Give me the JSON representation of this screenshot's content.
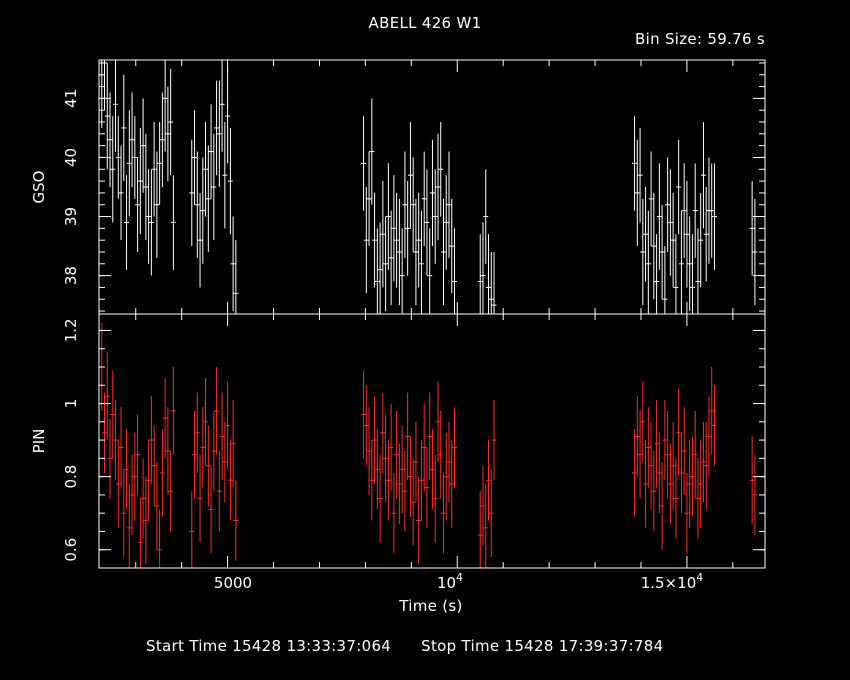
{
  "window": {
    "title": "ABELL 426 W1",
    "bin_size": "Bin Size: 59.76 s"
  },
  "footer": {
    "start": "Start Time 15428 13:33:37:064",
    "stop": "Stop Time 15428 17:39:37:784"
  },
  "colors": {
    "background": "#000000",
    "axes": "#ffffff",
    "gso_series": "#ffffff",
    "pin_series": "#ff2a2a"
  },
  "chart_data": [
    {
      "type": "scatter",
      "panel": "top",
      "ylabel": "GSO",
      "xlabel": "",
      "xlim": [
        2200,
        16700
      ],
      "ylim": [
        37.35,
        41.65
      ],
      "yticks": [
        38,
        39,
        40,
        41
      ],
      "grid": false,
      "series": [
        {
          "x": [
            2260,
            2320,
            2380,
            2440,
            2500,
            2560,
            2620,
            2680,
            2740,
            2800,
            2860,
            2920,
            2980,
            3040,
            3100,
            3160,
            3220,
            3280,
            3340,
            3400,
            3460,
            3520,
            3580,
            3640,
            3700,
            3760,
            3820,
            4220,
            4280,
            4340,
            4400,
            4460,
            4520,
            4580,
            4640,
            4700,
            4760,
            4820,
            4880,
            4940,
            5000,
            5060,
            5120,
            5180,
            7960,
            8020,
            8080,
            8140,
            8200,
            8260,
            8320,
            8380,
            8440,
            8500,
            8560,
            8620,
            8680,
            8740,
            8800,
            8860,
            8920,
            8980,
            9040,
            9100,
            9160,
            9220,
            9280,
            9340,
            9400,
            9460,
            9520,
            9580,
            9640,
            9700,
            9760,
            9820,
            9880,
            9940,
            10500,
            10560,
            10620,
            10680,
            10740,
            10800,
            13860,
            13920,
            13980,
            14040,
            14100,
            14160,
            14220,
            14280,
            14340,
            14400,
            14460,
            14520,
            14580,
            14640,
            14700,
            14760,
            14820,
            14880,
            14940,
            15000,
            15060,
            15120,
            15180,
            15240,
            15300,
            15360,
            15420,
            15480,
            15540,
            15600,
            16420,
            16480
          ],
          "y": [
            41.4,
            41.6,
            40.7,
            40.3,
            39.8,
            40.9,
            40.0,
            39.4,
            40.5,
            38.9,
            39.9,
            40.3,
            40.0,
            39.2,
            39.6,
            40.2,
            39.5,
            39.0,
            38.9,
            39.8,
            39.2,
            39.9,
            40.3,
            41.0,
            40.4,
            40.6,
            38.9,
            39.4,
            40.0,
            39.2,
            38.6,
            39.1,
            39.8,
            39.3,
            40.1,
            39.5,
            40.5,
            40.4,
            40.9,
            39.7,
            40.7,
            39.6,
            38.2,
            37.7,
            39.9,
            38.6,
            39.3,
            40.1,
            38.6,
            37.9,
            38.1,
            38.7,
            38.2,
            39.0,
            38.3,
            38.8,
            38.6,
            38.4,
            38.0,
            39.2,
            38.8,
            39.7,
            39.2,
            38.4,
            38.6,
            38.2,
            39.3,
            38.9,
            38.0,
            39.4,
            39.0,
            39.5,
            39.8,
            38.4,
            38.9,
            39.2,
            38.5,
            37.9,
            37.9,
            38.0,
            39.0,
            37.8,
            37.6,
            37.5,
            39.9,
            39.4,
            39.7,
            38.4,
            38.7,
            38.2,
            39.3,
            38.5,
            37.9,
            39.0,
            38.4,
            37.6,
            39.2,
            38.9,
            38.6,
            37.8,
            39.5,
            38.2,
            39.1,
            38.7,
            38.2,
            37.8,
            39.1,
            37.9,
            38.6,
            39.7,
            38.7,
            39.1,
            39.1,
            39.0,
            38.8,
            38.4
          ],
          "err": [
            0.9,
            0.8,
            0.9,
            0.8,
            0.9,
            0.8,
            0.7,
            0.8,
            0.9,
            0.8,
            0.9,
            0.8,
            0.7,
            0.8,
            0.9,
            0.8,
            0.9,
            0.8,
            0.9,
            0.8,
            0.9,
            0.7,
            0.8,
            0.9,
            0.8,
            0.9,
            0.8,
            0.9,
            0.8,
            0.9,
            0.8,
            0.9,
            0.8,
            0.9,
            0.8,
            0.9,
            0.8,
            0.9,
            0.8,
            0.9,
            0.8,
            0.9,
            0.8,
            0.9,
            0.8,
            0.9,
            0.8,
            0.9,
            0.8,
            0.9,
            0.8,
            0.9,
            0.8,
            0.9,
            0.8,
            0.9,
            0.8,
            0.9,
            0.8,
            0.9,
            0.8,
            0.9,
            0.8,
            0.9,
            0.8,
            0.9,
            0.8,
            0.9,
            0.8,
            0.9,
            0.8,
            0.9,
            0.8,
            0.9,
            0.8,
            0.9,
            0.8,
            0.9,
            0.8,
            0.9,
            0.8,
            0.9,
            0.8,
            0.9,
            0.8,
            0.9,
            0.8,
            0.9,
            0.8,
            0.9,
            0.8,
            0.9,
            0.8,
            0.9,
            0.8,
            0.9,
            0.8,
            0.9,
            0.8,
            0.9,
            0.8,
            0.9,
            0.8,
            0.9,
            0.8,
            0.9,
            0.8,
            0.9,
            0.8,
            0.9,
            0.8,
            0.9,
            0.8,
            0.9,
            0.8,
            0.9
          ]
        }
      ]
    },
    {
      "type": "scatter",
      "panel": "bottom",
      "ylabel": "PIN",
      "xlabel": "Time (s)",
      "xlim": [
        2200,
        16700
      ],
      "ylim": [
        0.55,
        1.245
      ],
      "yticks": [
        0.6,
        0.8,
        1,
        1.2
      ],
      "xticks": [
        "5000",
        "10^4",
        "1.5×10^4"
      ],
      "grid": false,
      "series": [
        {
          "x": [
            2260,
            2320,
            2380,
            2440,
            2500,
            2560,
            2620,
            2680,
            2740,
            2800,
            2860,
            2920,
            2980,
            3040,
            3100,
            3160,
            3220,
            3280,
            3340,
            3400,
            3460,
            3520,
            3580,
            3640,
            3700,
            3760,
            3820,
            4220,
            4280,
            4340,
            4400,
            4460,
            4520,
            4580,
            4640,
            4700,
            4760,
            4820,
            4880,
            4940,
            5000,
            5060,
            5120,
            5180,
            7960,
            8020,
            8080,
            8140,
            8200,
            8260,
            8320,
            8380,
            8440,
            8500,
            8560,
            8620,
            8680,
            8740,
            8800,
            8860,
            8920,
            8980,
            9040,
            9100,
            9160,
            9220,
            9280,
            9340,
            9400,
            9460,
            9520,
            9580,
            9640,
            9700,
            9760,
            9820,
            9880,
            9940,
            10500,
            10560,
            10620,
            10680,
            10740,
            10800,
            13860,
            13920,
            13980,
            14040,
            14100,
            14160,
            14220,
            14280,
            14340,
            14400,
            14460,
            14520,
            14580,
            14640,
            14700,
            14760,
            14820,
            14880,
            14940,
            15000,
            15060,
            15120,
            15180,
            15240,
            15300,
            15360,
            15420,
            15480,
            15540,
            15600,
            16420,
            16480
          ],
          "y": [
            1.1,
            0.92,
            1.02,
            0.85,
            0.97,
            0.9,
            0.78,
            0.88,
            0.7,
            0.82,
            0.66,
            0.75,
            0.8,
            0.86,
            0.62,
            0.74,
            0.68,
            0.79,
            0.9,
            0.83,
            0.72,
            0.6,
            0.81,
            0.96,
            0.87,
            0.76,
            0.98,
            0.65,
            0.86,
            0.92,
            0.74,
            0.88,
            0.95,
            0.83,
            0.71,
            0.87,
            0.98,
            0.76,
            0.91,
            0.84,
            0.94,
            0.79,
            0.89,
            0.68,
            0.97,
            0.94,
            0.87,
            0.79,
            0.9,
            0.82,
            0.74,
            0.92,
            0.85,
            0.79,
            0.88,
            0.7,
            0.86,
            0.78,
            0.82,
            0.76,
            0.91,
            0.8,
            0.73,
            0.84,
            0.68,
            0.79,
            0.88,
            0.77,
            0.91,
            0.82,
            0.74,
            0.95,
            0.86,
            0.7,
            0.8,
            0.84,
            0.78,
            0.88,
            0.64,
            0.72,
            0.66,
            0.79,
            0.7,
            0.9,
            0.81,
            0.91,
            0.86,
            0.95,
            0.78,
            0.88,
            0.83,
            0.76,
            0.89,
            0.81,
            0.72,
            0.9,
            0.86,
            0.78,
            0.83,
            0.74,
            0.92,
            0.81,
            0.87,
            0.7,
            0.78,
            0.8,
            0.86,
            0.74,
            0.78,
            0.84,
            0.83,
            0.91,
            0.98,
            0.94,
            0.79,
            0.75
          ],
          "err": [
            0.12,
            0.11,
            0.12,
            0.11,
            0.12,
            0.11,
            0.12,
            0.11,
            0.12,
            0.11,
            0.12,
            0.11,
            0.12,
            0.11,
            0.12,
            0.11,
            0.12,
            0.11,
            0.12,
            0.11,
            0.12,
            0.11,
            0.12,
            0.11,
            0.12,
            0.11,
            0.12,
            0.11,
            0.12,
            0.11,
            0.12,
            0.11,
            0.12,
            0.11,
            0.12,
            0.11,
            0.12,
            0.11,
            0.12,
            0.11,
            0.12,
            0.11,
            0.12,
            0.11,
            0.12,
            0.11,
            0.12,
            0.11,
            0.12,
            0.11,
            0.12,
            0.11,
            0.12,
            0.11,
            0.12,
            0.11,
            0.12,
            0.11,
            0.12,
            0.11,
            0.12,
            0.11,
            0.12,
            0.11,
            0.12,
            0.11,
            0.12,
            0.11,
            0.12,
            0.11,
            0.12,
            0.11,
            0.12,
            0.11,
            0.12,
            0.11,
            0.12,
            0.11,
            0.12,
            0.11,
            0.12,
            0.11,
            0.12,
            0.11,
            0.12,
            0.11,
            0.12,
            0.11,
            0.12,
            0.11,
            0.12,
            0.11,
            0.12,
            0.11,
            0.12,
            0.11,
            0.12,
            0.11,
            0.12,
            0.11,
            0.12,
            0.11,
            0.12,
            0.11,
            0.12,
            0.11,
            0.12,
            0.11,
            0.12,
            0.11,
            0.12,
            0.11,
            0.12,
            0.11,
            0.12,
            0.11
          ]
        }
      ]
    }
  ]
}
